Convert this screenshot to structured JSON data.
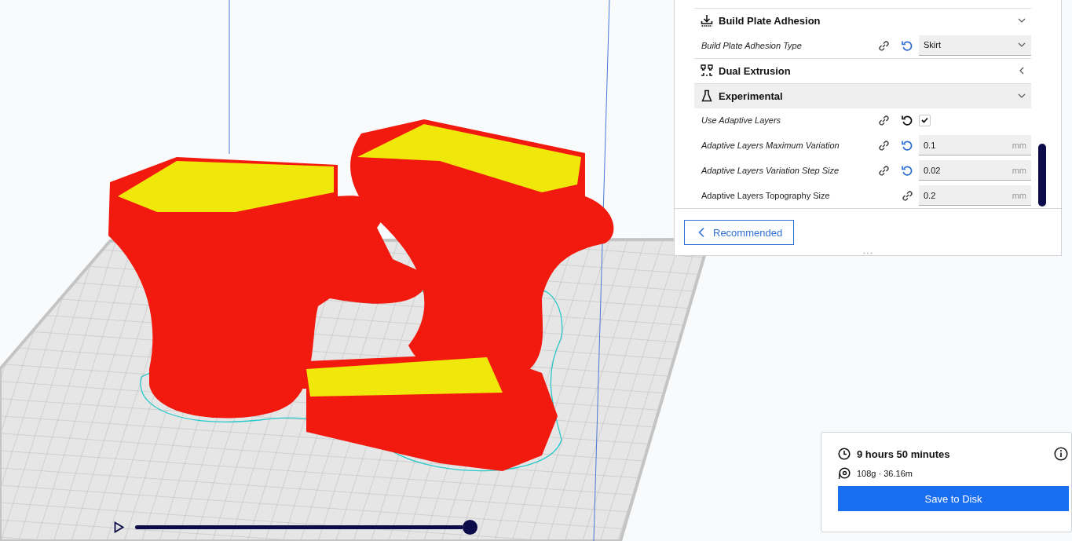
{
  "settings_panel": {
    "sections": [
      {
        "title": "Build Plate Adhesion",
        "expanded": true,
        "highlighted": false,
        "settings": [
          {
            "label": "Build Plate Adhesion Type",
            "kind": "dropdown",
            "value": "Skirt",
            "overridden": true,
            "reset": true,
            "hovered": false
          }
        ]
      },
      {
        "title": "Dual Extrusion",
        "expanded": false,
        "highlighted": false
      },
      {
        "title": "Experimental",
        "expanded": true,
        "highlighted": true,
        "settings": [
          {
            "label": "Use Adaptive Layers",
            "kind": "checkbox",
            "checked": true,
            "overridden": true,
            "reset": true,
            "hovered": true
          },
          {
            "label": "Adaptive Layers Maximum Variation",
            "kind": "number",
            "value": "0.1",
            "unit": "mm",
            "overridden": true,
            "reset": true,
            "hovered": false
          },
          {
            "label": "Adaptive Layers Variation Step Size",
            "kind": "number",
            "value": "0.02",
            "unit": "mm",
            "overridden": true,
            "reset": true,
            "hovered": false
          },
          {
            "label": "Adaptive Layers Topography Size",
            "kind": "number",
            "value": "0.2",
            "unit": "mm",
            "overridden": false,
            "reset": false
          }
        ]
      }
    ],
    "recommended_button": "Recommended"
  },
  "print_info": {
    "time": "9 hours 50 minutes",
    "material": "108g · 36.16m",
    "button": "Save to Disk"
  },
  "layer_slider": {
    "level": 1
  }
}
